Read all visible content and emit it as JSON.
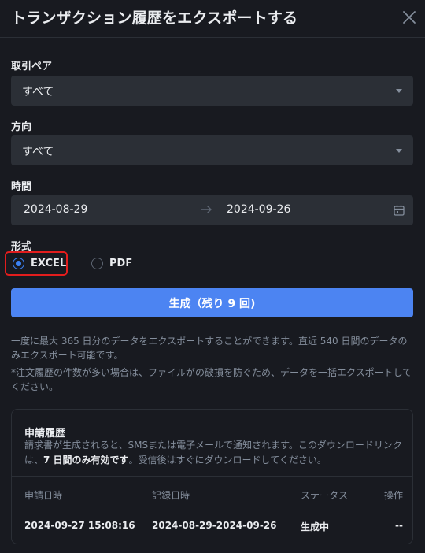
{
  "dialog": {
    "title": "トランザクション履歴をエクスポートする"
  },
  "form": {
    "pair_label": "取引ペア",
    "pair_value": "すべて",
    "direction_label": "方向",
    "direction_value": "すべて",
    "time_label": "時間",
    "start_date": "2024-08-29",
    "end_date": "2024-09-26",
    "format_label": "形式",
    "format_options": [
      {
        "label": "EXCEL",
        "selected": true
      },
      {
        "label": "PDF",
        "selected": false
      }
    ],
    "generate_button": "生成（残り 9 回)"
  },
  "notes": {
    "line1": "一度に最大 365 日分のデータをエクスポートすることができます。直近 540 日間のデータのみエクスポート可能です。",
    "line2": "*注文履歴の件数が多い場合は、ファイルがの破損を防ぐため、データを一括エクスポートしてください。"
  },
  "history": {
    "title": "申請履歴",
    "desc_pre": "請求書が生成されると、SMSまたは電子メールで通知されます。このダウンロードリンクは、",
    "desc_bold": "7 日間のみ有効です",
    "desc_post": "。受信後はすぐにダウンロードしてください。",
    "columns": [
      "申請日時",
      "記録日時",
      "ステータス",
      "操作"
    ],
    "rows": [
      {
        "requested": "2024-09-27 15:08:16",
        "recorded": "2024-08-29-2024-09-26",
        "status": "生成中",
        "action": "--"
      }
    ]
  },
  "colors": {
    "background": "#181a20",
    "field": "#2b2f36",
    "primary": "#4c84f2",
    "radio_selected": "#3b82f6",
    "highlight": "#e21d1d",
    "muted_text": "#848e9c"
  },
  "icons": [
    "close-icon",
    "chevron-down-icon",
    "arrow-right-icon",
    "calendar-icon"
  ]
}
